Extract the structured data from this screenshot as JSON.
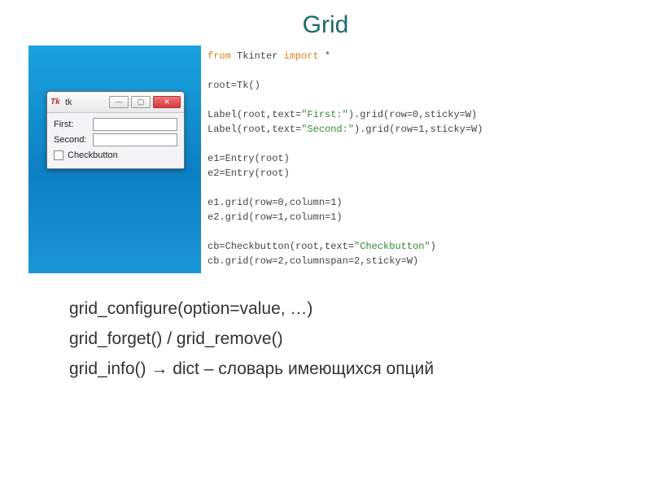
{
  "title": "Grid",
  "tk_window": {
    "title": "tk",
    "labels": {
      "first": "First:",
      "second": "Second:"
    },
    "checkbutton_label": "Checkbutton"
  },
  "code": {
    "l1a": "from",
    "l1b": " Tkinter ",
    "l1c": "import",
    "l1d": " *",
    "l3": "root=Tk()",
    "l5a": "Label(root,text=",
    "l5b": "\"First:\"",
    "l5c": ").grid(row=0,sticky=W)",
    "l6a": "Label(root,text=",
    "l6b": "\"Second:\"",
    "l6c": ").grid(row=1,sticky=W)",
    "l8": "e1=Entry(root)",
    "l9": "e2=Entry(root)",
    "l11": "e1.grid(row=0,column=1)",
    "l12": "e2.grid(row=1,column=1)",
    "l14a": "cb=Checkbutton(root,text=",
    "l14b": "\"Checkbutton\"",
    "l14c": ")",
    "l15": "cb.grid(row=2,columnspan=2,sticky=W)"
  },
  "methods": {
    "line1": "grid_configure(option=value, …)",
    "line2": "grid_forget() / grid_remove()",
    "line3": "grid_info() → dict – словарь имеющихся опций"
  }
}
